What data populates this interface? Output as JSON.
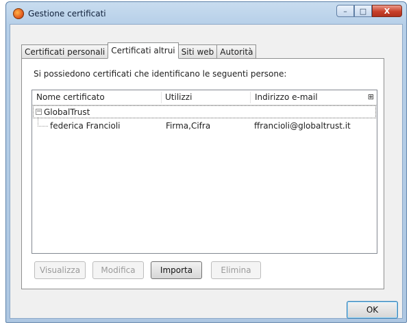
{
  "window": {
    "title": "Gestione certificati",
    "minimize": "–",
    "maximize": "□",
    "close": "X"
  },
  "tabs": [
    {
      "label": "Certificati personali",
      "active": false
    },
    {
      "label": "Certificati altrui",
      "active": true
    },
    {
      "label": "Siti web",
      "active": false
    },
    {
      "label": "Autorità",
      "active": false
    }
  ],
  "panel": {
    "description": "Si possiedono certificati che identificano le seguenti persone:",
    "columns": [
      "Nome certificato",
      "Utilizzi",
      "Indirizzo e-mail"
    ],
    "column_picker_icon": "⊞",
    "tree": {
      "group": {
        "toggle": "−",
        "name": "GlobalTrust"
      },
      "child": {
        "name": "federica Francioli",
        "usage": "Firma,Cifra",
        "email": "ffrancioli@globaltrust.it"
      }
    }
  },
  "buttons": {
    "view": "Visualizza",
    "edit": "Modifica",
    "import": "Importa",
    "delete": "Elimina",
    "ok": "OK"
  }
}
